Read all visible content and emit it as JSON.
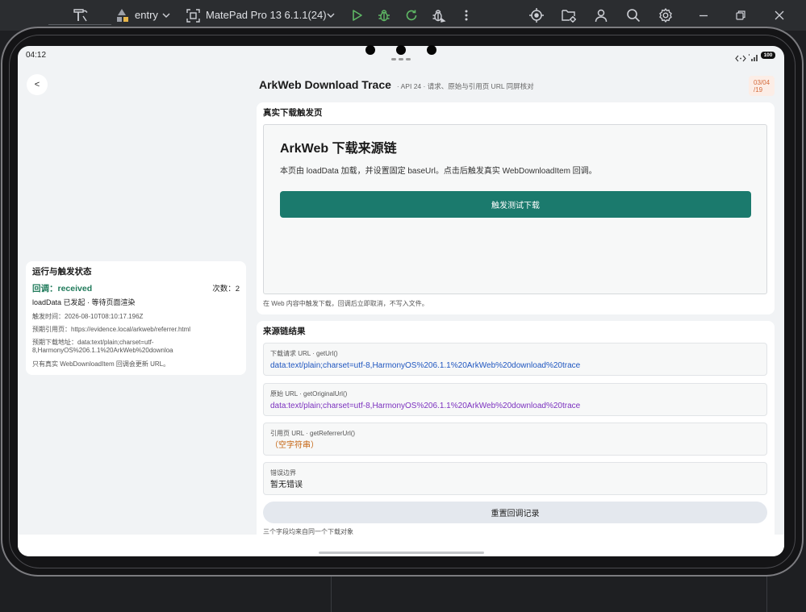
{
  "ide": {
    "module": "entry",
    "device": "MatePad Pro 13 6.1.1(24)",
    "toolbar_icons": [
      "build-icon",
      "module-icon",
      "device-icon",
      "run-icon",
      "debug-icon",
      "apply-changes-icon",
      "attach-debugger-icon",
      "more-icon",
      "target-icon",
      "project-files-icon",
      "account-icon",
      "search-icon",
      "settings-icon",
      "minimize-icon",
      "restore-icon",
      "close-icon"
    ],
    "colors": {
      "toolbar_bg": "#2b2d30",
      "run_green": "#5fb865"
    }
  },
  "status_bar": {
    "time": "04:12",
    "battery": "100"
  },
  "header": {
    "back_label": "<",
    "title": "ArkWeb Download Trace",
    "subtitle": "· API 24 · 请求、原始与引用页 URL 同屏核对",
    "date_line1": "03/04",
    "date_line2": "/19"
  },
  "status_card": {
    "title": "运行与触发状态",
    "callback": "回调：received",
    "count": "次数：2",
    "message": "loadData 已发起 · 等待页面渲染",
    "trigger_time": "触发时间：2026-08-10T08:10:17.196Z",
    "expected_referrer": "预期引用页：https://evidence.local/arkweb/referrer.html",
    "expected_download": "预期下载地址：data:text/plain;charset=utf-8,HarmonyOS%206.1.1%20ArkWeb%20downloa",
    "note": "只有真实 WebDownloadItem 回调会更新 URL。"
  },
  "trigger_page": {
    "section_title": "真实下载触发页",
    "web_title": "ArkWeb 下载来源链",
    "web_desc": "本页由 loadData 加载，并设置固定 baseUrl。点击后触发真实 WebDownloadItem 回调。",
    "button": "触发测试下载",
    "footnote": "在 Web 内容中触发下载，回调后立即取消，不写入文件。"
  },
  "results": {
    "section_title": "来源链结果",
    "items": [
      {
        "label": "下载请求 URL · getUrl()",
        "value": "data:text/plain;charset=utf-8,HarmonyOS%206.1.1%20ArkWeb%20download%20trace",
        "color": "#1f56c0"
      },
      {
        "label": "原始 URL · getOriginalUrl()",
        "value": "data:text/plain;charset=utf-8,HarmonyOS%206.1.1%20ArkWeb%20download%20trace",
        "color": "#7b30bf"
      },
      {
        "label": "引用页 URL · getReferrerUrl()",
        "value": "（空字符串）",
        "color": "#c4610c"
      },
      {
        "label": "错误边界",
        "value": "暂无错误",
        "color": "#222222"
      }
    ],
    "reset_button": "重置回调记录",
    "footnote": "三个字段均来自同一个下载对象"
  },
  "colors": {
    "callback_green": "#1f7a5a",
    "accent_teal": "#1b7a6d",
    "date_badge_text": "#d46a3a",
    "date_badge_bg": "#fcede6"
  }
}
